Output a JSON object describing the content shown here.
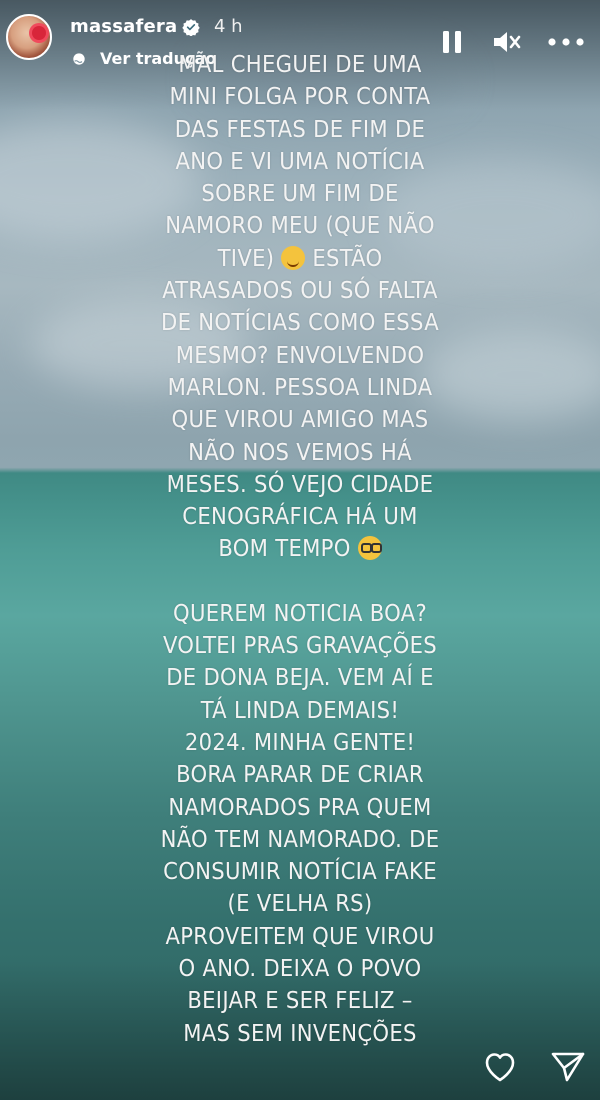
{
  "story": {
    "username": "massafera",
    "time": "4 h",
    "translate_label": "Ver tradução",
    "text_lines": [
      "MAL CHEGUEI DE UMA",
      "MINI FOLGA POR CONTA",
      "DAS FESTAS DE FIM DE",
      "ANO E VI UMA NOTÍCIA",
      "SOBRE UM FIM DE",
      "NAMORO MEU (QUE NÃO",
      "TIVE)",
      "ESTÃO",
      "ATRASADOS OU SÓ FALTA",
      "DE NOTÍCIAS COMO ESSA",
      "MESMO?  ENVOLVENDO",
      "MARLON. PESSOA LINDA",
      "QUE VIROU AMIGO MAS",
      "NÃO NOS VEMOS HÁ",
      "MESES. SÓ VEJO CIDADE",
      "CENOGRÁFICA HÁ UM",
      "BOM TEMPO",
      "QUEREM NOTICIA BOA?",
      "VOLTEI PRAS GRAVAÇÕES",
      "DE DONA BEJA. VEM AÍ E",
      "TÁ LINDA DEMAIS!",
      "2024. MINHA GENTE!",
      "BORA PARAR DE CRIAR",
      "NAMORADOS PRA QUEM",
      "NÃO TEM NAMORADO. DE",
      "CONSUMIR NOTÍCIA FAKE",
      "(E VELHA RS)",
      "APROVEITEM QUE VIROU",
      "O ANO. DEIXA O POVO",
      "BEIJAR E SER FELIZ –",
      "MAS SEM INVENÇÕES"
    ]
  },
  "icons": {
    "verified": "verified-badge-icon",
    "translate": "globe-icon",
    "pause": "pause-icon",
    "mute": "speaker-muted-icon",
    "more": "more-horizontal-icon",
    "emoji_wink": "winking-tongue-emoji",
    "emoji_glasses": "nerd-glasses-emoji",
    "like": "heart-icon",
    "share": "send-icon"
  },
  "colors": {
    "text": "#f3f3f3",
    "verified": "#ffffff",
    "sea": "#4f9d96",
    "sky": "#9fb3bd"
  }
}
